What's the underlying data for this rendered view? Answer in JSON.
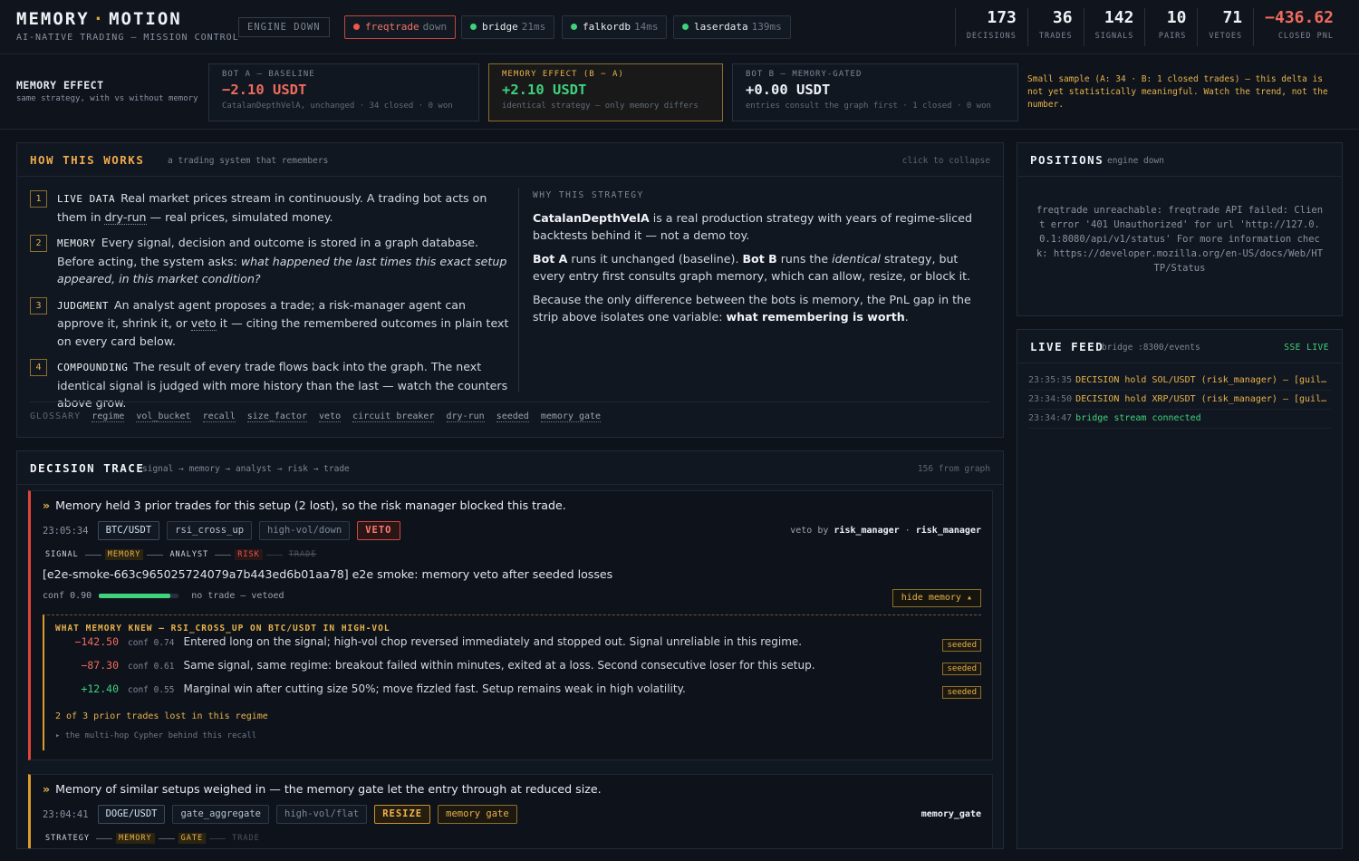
{
  "header": {
    "brand_left": "MEMORY",
    "brand_sep": "·",
    "brand_right": "MOTION",
    "subtitle": "AI-NATIVE TRADING — MISSION CONTROL",
    "engine_status": "ENGINE DOWN",
    "services": [
      {
        "name": "freqtrade",
        "latency": "down",
        "status_color": "#f0564a"
      },
      {
        "name": "bridge",
        "latency": "21ms",
        "status_color": "#3fd27c"
      },
      {
        "name": "falkordb",
        "latency": "14ms",
        "status_color": "#3fd27c"
      },
      {
        "name": "laserdata",
        "latency": "139ms",
        "status_color": "#3fd27c"
      }
    ],
    "stats": [
      {
        "value": "173",
        "label": "DECISIONS"
      },
      {
        "value": "36",
        "label": "TRADES"
      },
      {
        "value": "142",
        "label": "SIGNALS"
      },
      {
        "value": "10",
        "label": "PAIRS"
      },
      {
        "value": "71",
        "label": "VETOES"
      },
      {
        "value": "−436.62",
        "label": "CLOSED PNL"
      }
    ]
  },
  "effect": {
    "title": "MEMORY EFFECT",
    "subtitle": "same strategy, with vs without memory",
    "bot_a": {
      "heading": "BOT A — BASELINE",
      "value": "−2.10 USDT",
      "sub": "CatalanDepthVelA, unchanged · 34 closed · 0 won"
    },
    "delta": {
      "heading": "MEMORY EFFECT (B − A)",
      "value": "+2.10 USDT",
      "sub": "identical strategy — only memory differs"
    },
    "bot_b": {
      "heading": "BOT B — MEMORY-GATED",
      "value": "+0.00 USDT",
      "sub": "entries consult the graph first · 1 closed · 0 won"
    },
    "note": "Small sample (A: 34 · B: 1 closed trades) — this delta is not yet statistically meaningful. Watch the trend, not the number."
  },
  "how": {
    "title": "HOW THIS WORKS",
    "subtitle": "a trading system that remembers",
    "collapse": "click to collapse",
    "steps": [
      {
        "num": "1",
        "key": "LIVE DATA",
        "a": "Real market prices stream in continuously. A trading bot acts on them in ",
        "u": "dry-run",
        "b": " — real prices, simulated money."
      },
      {
        "num": "2",
        "key": "MEMORY",
        "a": "Every signal, decision and outcome is stored in a graph database. Before acting, the system asks: ",
        "i": "what happened the last times this exact setup appeared, in this market condition?"
      },
      {
        "num": "3",
        "key": "JUDGMENT",
        "a": "An analyst agent proposes a trade; a risk-manager agent can approve it, shrink it, or ",
        "u": "veto",
        "b": " it — citing the remembered outcomes in plain text on every card below."
      },
      {
        "num": "4",
        "key": "COMPOUNDING",
        "a": "The result of every trade flows back into the graph. The next identical signal is judged with more history than the last — watch the counters above grow."
      }
    ],
    "why_heading": "WHY THIS STRATEGY",
    "why_p1_b": "CatalanDepthVelA",
    "why_p1": " is a real production strategy with years of regime-sliced backtests behind it — not a demo toy.",
    "why_p2_b1": "Bot A",
    "why_p2_1": " runs it unchanged (baseline). ",
    "why_p2_b2": "Bot B",
    "why_p2_2": " runs the ",
    "why_p2_i": "identical",
    "why_p2_3": " strategy, but every entry first consults graph memory, which can allow, resize, or block it.",
    "why_p3": "Because the only difference between the bots is memory, the PnL gap in the strip above isolates one variable: ",
    "why_p3_b": "what remembering is worth",
    "why_p3_end": ".",
    "glossary_label": "GLOSSARY",
    "glossary": [
      "regime",
      "vol_bucket",
      "recall",
      "size_factor",
      "veto",
      "circuit breaker",
      "dry-run",
      "seeded",
      "memory gate"
    ]
  },
  "trace": {
    "title": "DECISION TRACE",
    "subtitle": "signal → memory → analyst → risk → trade",
    "count": "156 from graph",
    "card1": {
      "chevron": "»",
      "message": "Memory held 3 prior trades for this setup (2 lost), so the risk manager blocked this trade.",
      "time": "23:05:34",
      "pair": "BTC/USDT",
      "signal": "rsi_cross_up",
      "regime": "high-vol/down",
      "action": "VETO",
      "veto_by_label": "veto by",
      "veto_by": "risk_manager",
      "sep": "·",
      "agent": "risk_manager",
      "stages": [
        "SIGNAL",
        "MEMORY",
        "ANALYST",
        "RISK",
        "TRADE"
      ],
      "body": "[e2e-smoke-663c965025724079a7b443ed6b01aa78] e2e smoke: memory veto after seeded losses",
      "conf_label": "conf 0.90",
      "confidence": 0.9,
      "outcome": "no trade — vetoed",
      "hide_label": "hide memory ▴",
      "memory_heading": "WHAT MEMORY KNEW — RSI_CROSS_UP ON BTC/USDT IN HIGH-VOL",
      "memories": [
        {
          "pnl": "−142.50",
          "conf": "conf 0.74",
          "text": "Entered long on the signal; high-vol chop reversed immediately and stopped out. Signal unreliable in this regime.",
          "tag": "seeded",
          "sign": "neg"
        },
        {
          "pnl": "−87.30",
          "conf": "conf 0.61",
          "text": "Same signal, same regime: breakout failed within minutes, exited at a loss. Second consecutive loser for this setup.",
          "tag": "seeded",
          "sign": "neg"
        },
        {
          "pnl": "+12.40",
          "conf": "conf 0.55",
          "text": "Marginal win after cutting size 50%; move fizzled fast. Setup remains weak in high volatility.",
          "tag": "seeded",
          "sign": "pos"
        }
      ],
      "summary": "2 of 3 prior trades lost in this regime",
      "cypher": "▸ the multi-hop Cypher behind this recall"
    },
    "card2": {
      "chevron": "»",
      "message": "Memory of similar setups weighed in — the memory gate let the entry through at reduced size.",
      "time": "23:04:41",
      "pair": "DOGE/USDT",
      "signal": "gate_aggregate",
      "regime": "high-vol/flat",
      "action": "RESIZE",
      "gate": "memory gate",
      "agent": "memory_gate",
      "stages": [
        "STRATEGY",
        "MEMORY",
        "GATE",
        "TRADE"
      ]
    }
  },
  "positions": {
    "title": "POSITIONS",
    "subtitle": "engine down",
    "error": "freqtrade unreachable: freqtrade API failed: Client error '401 Unauthorized' for url 'http://127.0.0.1:8080/api/v1/status' For more information check: https://developer.mozilla.org/en-US/docs/Web/HTTP/Status"
  },
  "feed": {
    "title": "LIVE FEED",
    "subtitle": "bridge :8300/events",
    "live": "SSE LIVE",
    "items": [
      {
        "ts": "23:35:35",
        "text": "DECISION hold SOL/USDT (risk_manager) — [guil…",
        "kind": "dec"
      },
      {
        "ts": "23:34:50",
        "text": "DECISION hold XRP/USDT (risk_manager) — [guil…",
        "kind": "dec"
      },
      {
        "ts": "23:34:47",
        "text": "bridge stream connected",
        "kind": "ok"
      }
    ]
  },
  "colors": {
    "accent": "#e8b24a",
    "positive": "#3fd27c",
    "negative": "#f06a5e",
    "background": "#0e121a"
  }
}
